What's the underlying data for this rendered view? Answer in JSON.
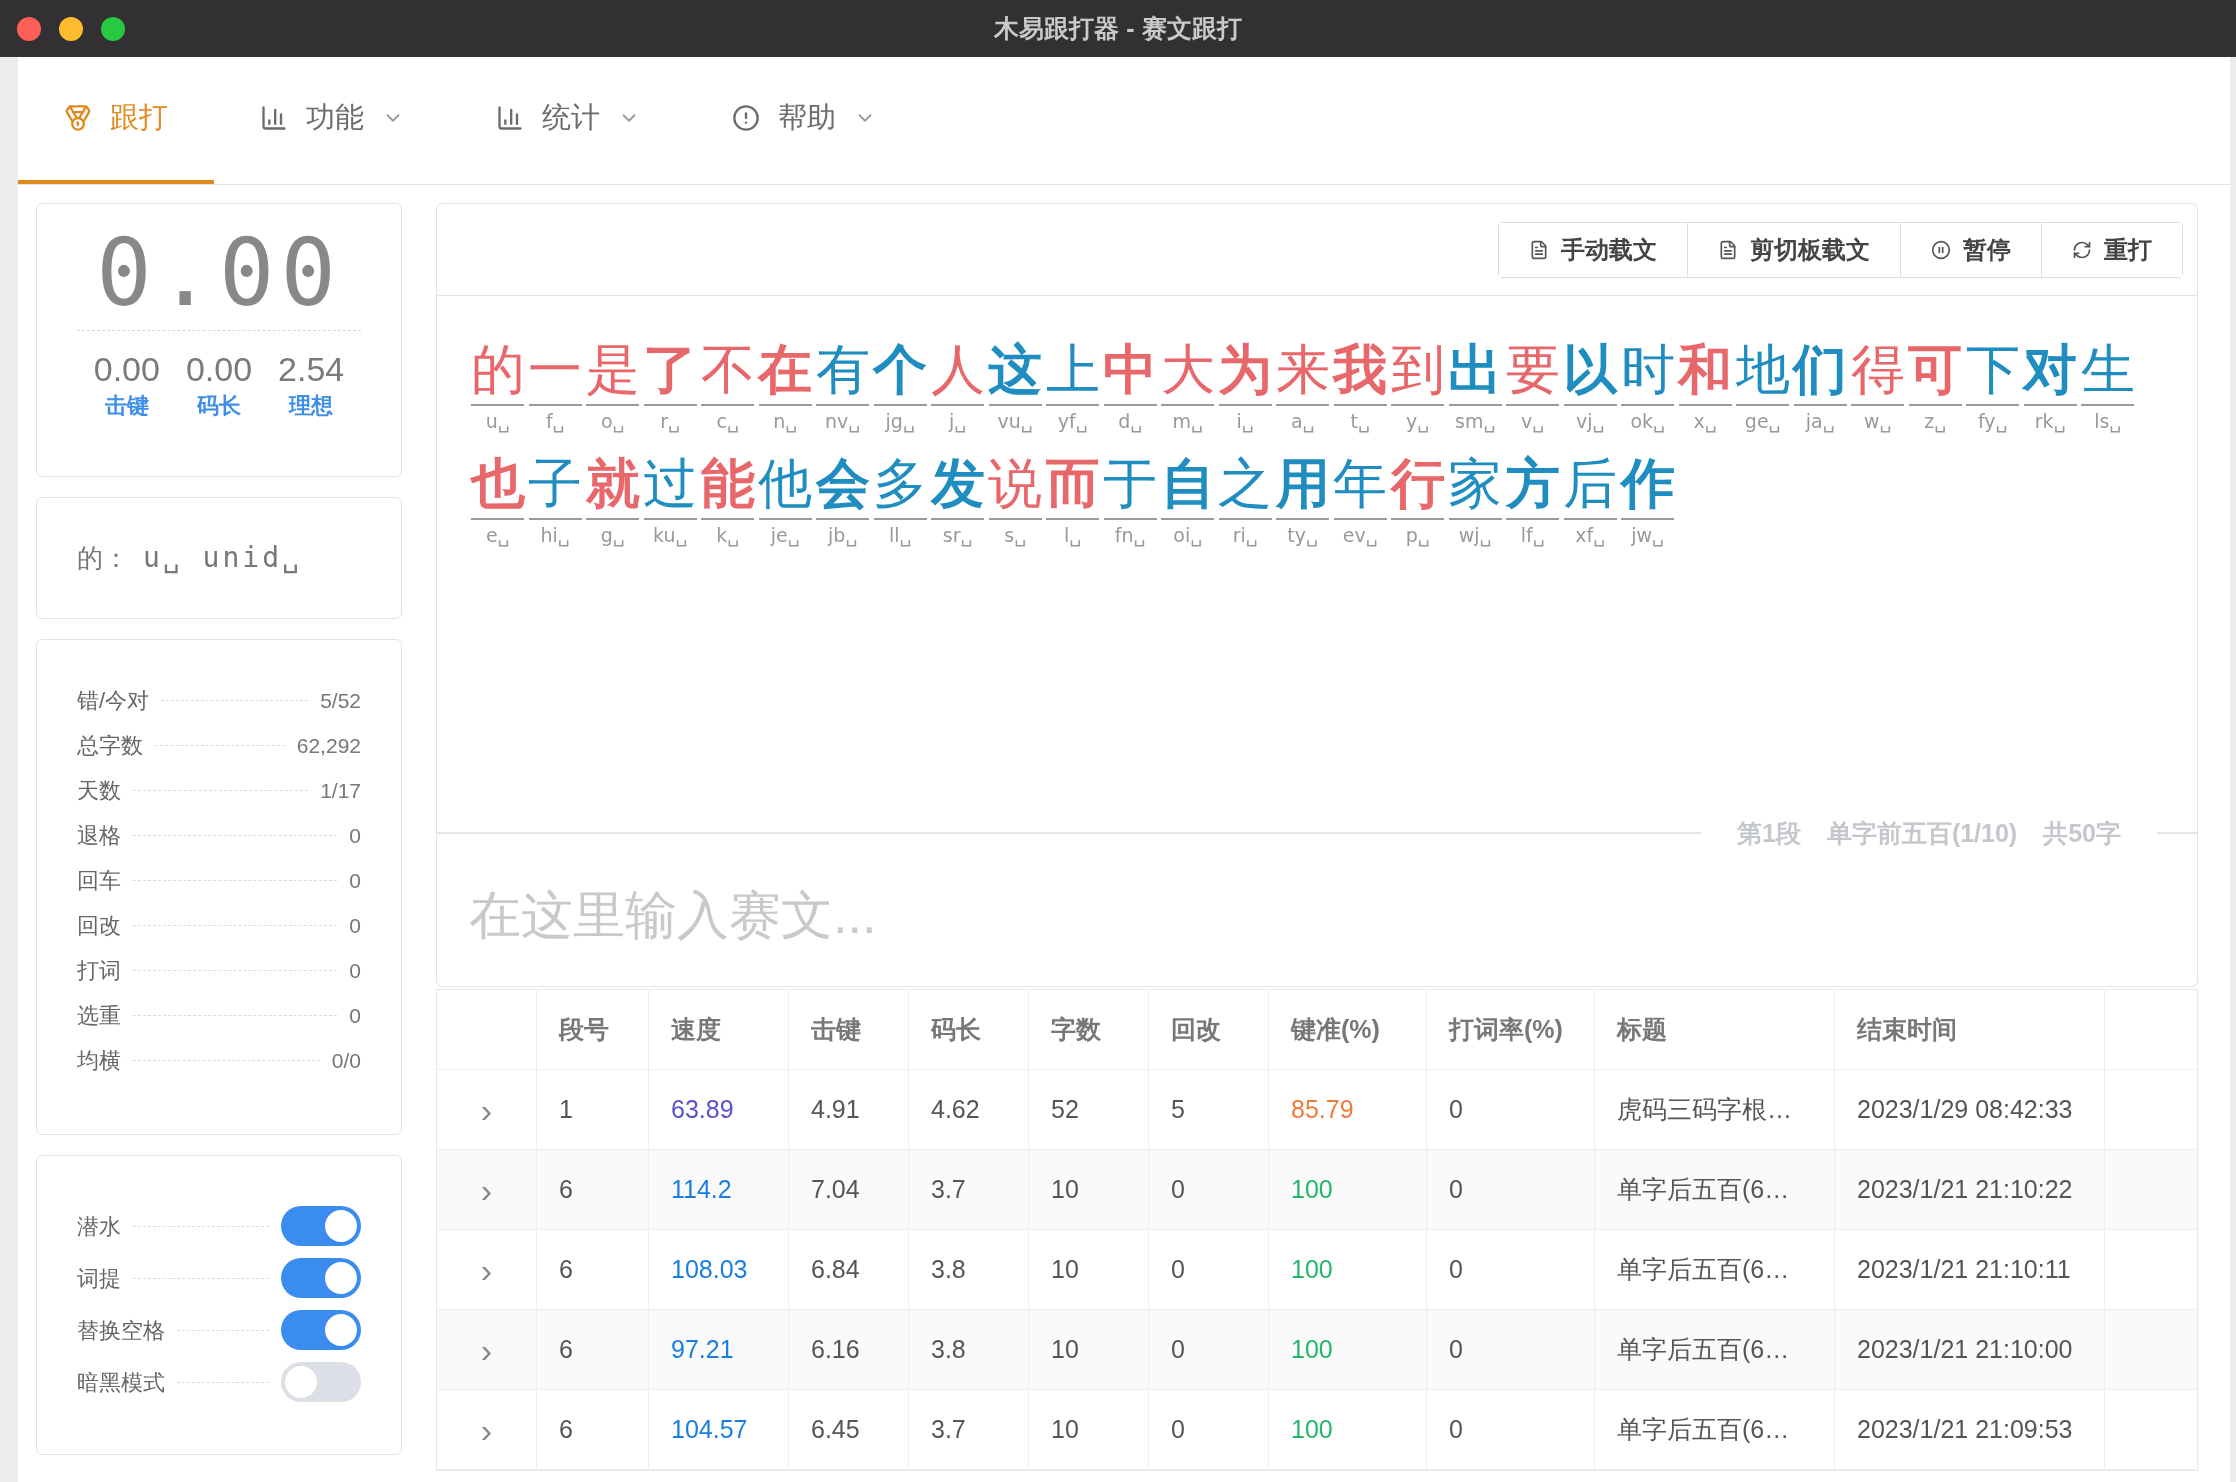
{
  "window": {
    "title": "木易跟打器 - 赛文跟打"
  },
  "tabs": [
    {
      "label": "跟打",
      "kind": "medal",
      "selected": true,
      "dropdown": false
    },
    {
      "label": "功能",
      "kind": "bars",
      "selected": false,
      "dropdown": true
    },
    {
      "label": "统计",
      "kind": "bars",
      "selected": false,
      "dropdown": true
    },
    {
      "label": "帮助",
      "kind": "alert",
      "selected": false,
      "dropdown": true
    }
  ],
  "speed_panel": {
    "speed": "0.00",
    "metrics": [
      {
        "value": "0.00",
        "label": "击键"
      },
      {
        "value": "0.00",
        "label": "码长"
      },
      {
        "value": "2.54",
        "label": "理想"
      }
    ]
  },
  "hint_panel": {
    "char": "的：",
    "codes": "u␣ unid␣"
  },
  "stats": [
    {
      "label": "错/今对",
      "value": "5/52"
    },
    {
      "label": "总字数",
      "value": "62,292"
    },
    {
      "label": "天数",
      "value": "1/17"
    },
    {
      "label": "退格",
      "value": "0"
    },
    {
      "label": "回车",
      "value": "0"
    },
    {
      "label": "回改",
      "value": "0"
    },
    {
      "label": "打词",
      "value": "0"
    },
    {
      "label": "选重",
      "value": "0"
    },
    {
      "label": "均横",
      "value": "0/0"
    }
  ],
  "switches": [
    {
      "label": "潜水",
      "on": true
    },
    {
      "label": "词提",
      "on": true
    },
    {
      "label": "替换空格",
      "on": true
    },
    {
      "label": "暗黑模式",
      "on": false
    }
  ],
  "toolbar": [
    {
      "label": "手动载文",
      "kind": "file"
    },
    {
      "label": "剪切板载文",
      "kind": "file"
    },
    {
      "label": "暂停",
      "kind": "pause"
    },
    {
      "label": "重打",
      "kind": "refresh"
    }
  ],
  "text": [
    {
      "char": "的",
      "code": "u␣",
      "color": "#e8676a",
      "bold": false
    },
    {
      "char": "一",
      "code": "f␣",
      "color": "#e8676a",
      "bold": false
    },
    {
      "char": "是",
      "code": "o␣",
      "color": "#e8676a",
      "bold": false
    },
    {
      "char": "了",
      "code": "r␣",
      "color": "#e8676a",
      "bold": true
    },
    {
      "char": "不",
      "code": "c␣",
      "color": "#e8676a",
      "bold": false
    },
    {
      "char": "在",
      "code": "n␣",
      "color": "#e8676a",
      "bold": true
    },
    {
      "char": "有",
      "code": "nv␣",
      "color": "#1f8dbf",
      "bold": false
    },
    {
      "char": "个",
      "code": "jg␣",
      "color": "#1f8dbf",
      "bold": true
    },
    {
      "char": "人",
      "code": "j␣",
      "color": "#e8676a",
      "bold": false
    },
    {
      "char": "这",
      "code": "vu␣",
      "color": "#1f8dbf",
      "bold": true
    },
    {
      "char": "上",
      "code": "yf␣",
      "color": "#1f8dbf",
      "bold": false
    },
    {
      "char": "中",
      "code": "d␣",
      "color": "#e8676a",
      "bold": true
    },
    {
      "char": "大",
      "code": "m␣",
      "color": "#e8676a",
      "bold": false
    },
    {
      "char": "为",
      "code": "i␣",
      "color": "#e8676a",
      "bold": true
    },
    {
      "char": "来",
      "code": "a␣",
      "color": "#e8676a",
      "bold": false
    },
    {
      "char": "我",
      "code": "t␣",
      "color": "#e8676a",
      "bold": true
    },
    {
      "char": "到",
      "code": "y␣",
      "color": "#e8676a",
      "bold": false
    },
    {
      "char": "出",
      "code": "sm␣",
      "color": "#1f8dbf",
      "bold": true
    },
    {
      "char": "要",
      "code": "v␣",
      "color": "#e8676a",
      "bold": false
    },
    {
      "char": "以",
      "code": "vj␣",
      "color": "#1f8dbf",
      "bold": true
    },
    {
      "char": "时",
      "code": "ok␣",
      "color": "#1f8dbf",
      "bold": false
    },
    {
      "char": "和",
      "code": "x␣",
      "color": "#e8676a",
      "bold": true
    },
    {
      "char": "地",
      "code": "ge␣",
      "color": "#1f8dbf",
      "bold": false
    },
    {
      "char": "们",
      "code": "ja␣",
      "color": "#1f8dbf",
      "bold": true
    },
    {
      "char": "得",
      "code": "w␣",
      "color": "#e8676a",
      "bold": false
    },
    {
      "char": "可",
      "code": "z␣",
      "color": "#e8676a",
      "bold": true
    },
    {
      "char": "下",
      "code": "fy␣",
      "color": "#1f8dbf",
      "bold": false
    },
    {
      "char": "对",
      "code": "rk␣",
      "color": "#1f8dbf",
      "bold": true
    },
    {
      "char": "生",
      "code": "ls␣",
      "color": "#1f8dbf",
      "bold": false
    },
    {
      "char": "也",
      "code": "e␣",
      "color": "#e8676a",
      "bold": true
    },
    {
      "char": "子",
      "code": "hi␣",
      "color": "#1f8dbf",
      "bold": false
    },
    {
      "char": "就",
      "code": "g␣",
      "color": "#e8676a",
      "bold": true
    },
    {
      "char": "过",
      "code": "ku␣",
      "color": "#1f8dbf",
      "bold": false
    },
    {
      "char": "能",
      "code": "k␣",
      "color": "#e8676a",
      "bold": true
    },
    {
      "char": "他",
      "code": "je␣",
      "color": "#1f8dbf",
      "bold": false
    },
    {
      "char": "会",
      "code": "jb␣",
      "color": "#1f8dbf",
      "bold": true
    },
    {
      "char": "多",
      "code": "ll␣",
      "color": "#1f8dbf",
      "bold": false
    },
    {
      "char": "发",
      "code": "sr␣",
      "color": "#1f8dbf",
      "bold": true
    },
    {
      "char": "说",
      "code": "s␣",
      "color": "#e8676a",
      "bold": false
    },
    {
      "char": "而",
      "code": "l␣",
      "color": "#e8676a",
      "bold": true
    },
    {
      "char": "于",
      "code": "fn␣",
      "color": "#1f8dbf",
      "bold": false
    },
    {
      "char": "自",
      "code": "oi␣",
      "color": "#1f8dbf",
      "bold": true
    },
    {
      "char": "之",
      "code": "ri␣",
      "color": "#1f8dbf",
      "bold": false
    },
    {
      "char": "用",
      "code": "ty␣",
      "color": "#1f8dbf",
      "bold": true
    },
    {
      "char": "年",
      "code": "ev␣",
      "color": "#1f8dbf",
      "bold": false
    },
    {
      "char": "行",
      "code": "p␣",
      "color": "#e8676a",
      "bold": true
    },
    {
      "char": "家",
      "code": "wj␣",
      "color": "#1f8dbf",
      "bold": false
    },
    {
      "char": "方",
      "code": "lf␣",
      "color": "#1f8dbf",
      "bold": true
    },
    {
      "char": "后",
      "code": "xf␣",
      "color": "#1f8dbf",
      "bold": false
    },
    {
      "char": "作",
      "code": "jw␣",
      "color": "#1f8dbf",
      "bold": true
    }
  ],
  "status": [
    "第1段",
    "单字前五百(1/10)",
    "共50字"
  ],
  "input": {
    "placeholder": "在这里输入赛文..."
  },
  "table": {
    "columns": [
      "段号",
      "速度",
      "击键",
      "码长",
      "字数",
      "回改",
      "键准(%)",
      "打词率(%)",
      "标题",
      "结束时间"
    ],
    "rows": [
      {
        "expand": "›",
        "no": "1",
        "speed": {
          "text": "63.89",
          "color": "#5a4fcf"
        },
        "keys": "4.91",
        "code_len": "4.62",
        "chars": "52",
        "revisions": "5",
        "accuracy": {
          "text": "85.79",
          "color": "#f07a3a"
        },
        "word_rate": "0",
        "title": "虎码三码字根…",
        "end": "2023/1/29 08:42:33"
      },
      {
        "expand": "›",
        "no": "6",
        "speed": {
          "text": "114.2",
          "color": "#1a7ee0"
        },
        "keys": "7.04",
        "code_len": "3.7",
        "chars": "10",
        "revisions": "0",
        "accuracy": {
          "text": "100",
          "color": "#1fb86a"
        },
        "word_rate": "0",
        "title": "单字后五百(6…",
        "end": "2023/1/21 21:10:22"
      },
      {
        "expand": "›",
        "no": "6",
        "speed": {
          "text": "108.03",
          "color": "#1a7ee0"
        },
        "keys": "6.84",
        "code_len": "3.8",
        "chars": "10",
        "revisions": "0",
        "accuracy": {
          "text": "100",
          "color": "#1fb86a"
        },
        "word_rate": "0",
        "title": "单字后五百(6…",
        "end": "2023/1/21 21:10:11"
      },
      {
        "expand": "›",
        "no": "6",
        "speed": {
          "text": "97.21",
          "color": "#1a7ee0"
        },
        "keys": "6.16",
        "code_len": "3.8",
        "chars": "10",
        "revisions": "0",
        "accuracy": {
          "text": "100",
          "color": "#1fb86a"
        },
        "word_rate": "0",
        "title": "单字后五百(6…",
        "end": "2023/1/21 21:10:00"
      },
      {
        "expand": "›",
        "no": "6",
        "speed": {
          "text": "104.57",
          "color": "#1a7ee0"
        },
        "keys": "6.45",
        "code_len": "3.7",
        "chars": "10",
        "revisions": "0",
        "accuracy": {
          "text": "100",
          "color": "#1fb86a"
        },
        "word_rate": "0",
        "title": "单字后五百(6…",
        "end": "2023/1/21 21:09:53"
      }
    ]
  }
}
